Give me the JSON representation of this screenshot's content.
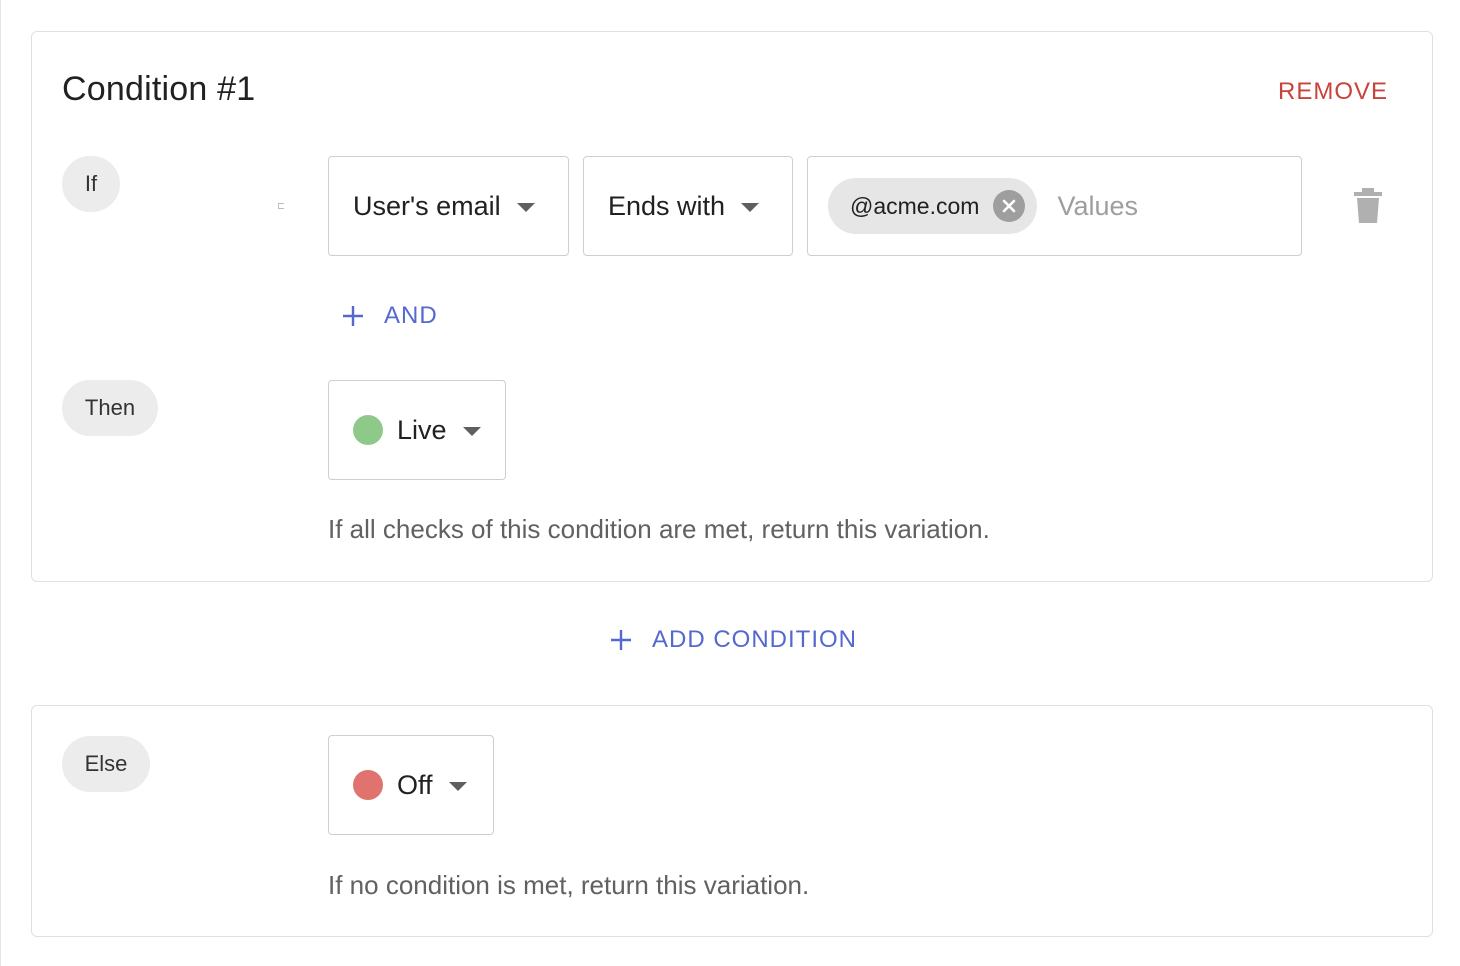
{
  "condition": {
    "title": "Condition #1",
    "remove_label": "REMOVE",
    "if_label": "If",
    "field": {
      "label": "User's email"
    },
    "operator": {
      "label": "Ends with"
    },
    "values": {
      "chips": [
        "@acme.com"
      ],
      "placeholder": "Values"
    },
    "add_and_label": "AND",
    "then_label": "Then",
    "then_variation": {
      "label": "Live",
      "color": "#8fc98a"
    },
    "helper_text": "If all checks of this condition are met, return this variation."
  },
  "add_condition_label": "ADD CONDITION",
  "else_block": {
    "else_label": "Else",
    "variation": {
      "label": "Off",
      "color": "#e0736d"
    },
    "helper_text": "If no condition is met, return this variation."
  },
  "icons": {
    "delete": "trash-icon",
    "plus": "plus-icon",
    "caret": "caret-down-icon",
    "chip_remove": "close-circle-icon"
  },
  "colors": {
    "accent": "#5468d1",
    "danger": "#c9433a"
  }
}
